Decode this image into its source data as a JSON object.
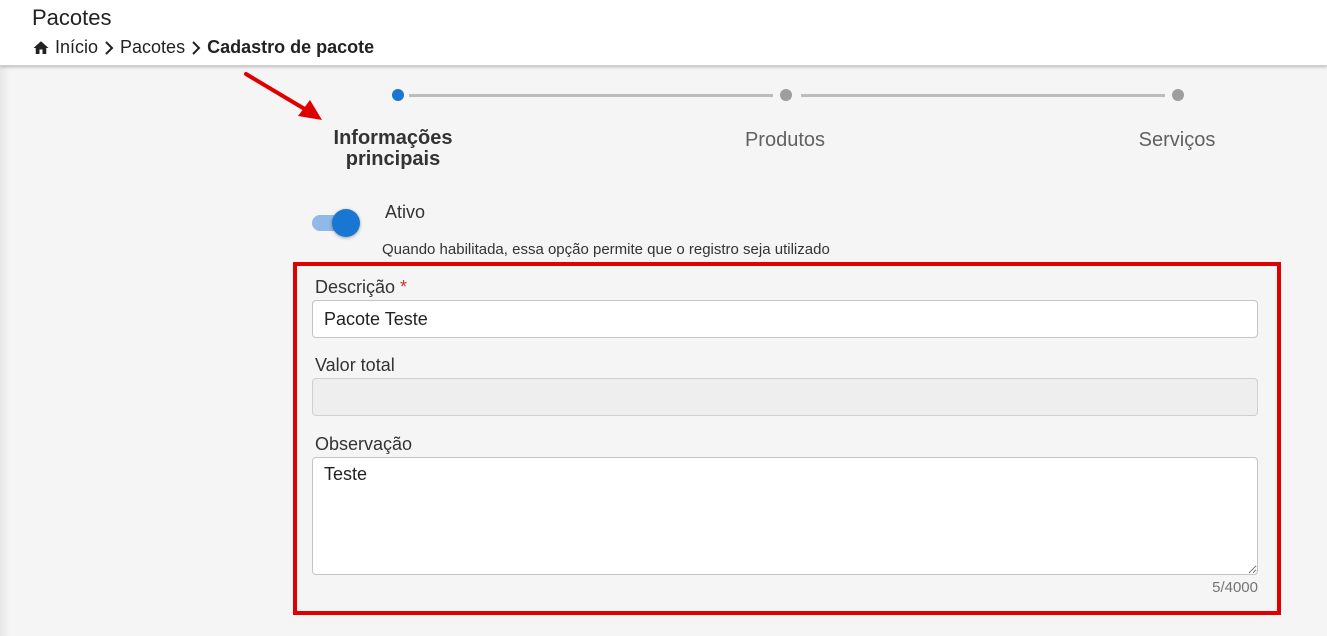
{
  "header": {
    "title": "Pacotes",
    "breadcrumb": [
      {
        "label": "Início",
        "icon": "home-icon"
      },
      {
        "label": "Pacotes"
      },
      {
        "label": "Cadastro de pacote"
      }
    ]
  },
  "stepper": {
    "steps": [
      {
        "label_line1": "Informações",
        "label_line2": "principais",
        "active": true
      },
      {
        "label": "Produtos",
        "active": false
      },
      {
        "label": "Serviços",
        "active": false
      }
    ],
    "active_color": "#1976d2",
    "inactive_color": "#9e9e9e"
  },
  "toggle": {
    "label": "Ativo",
    "hint": "Quando habilitada, essa opção permite que o registro seja utilizado",
    "checked": true
  },
  "form": {
    "descricao": {
      "label": "Descrição",
      "required_mark": "*",
      "value": "Pacote Teste"
    },
    "valor_total": {
      "label": "Valor total",
      "value": ""
    },
    "observacao": {
      "label": "Observação",
      "value": "Teste",
      "counter": "5/4000"
    }
  },
  "annotation": {
    "highlight_color": "#e00000"
  }
}
